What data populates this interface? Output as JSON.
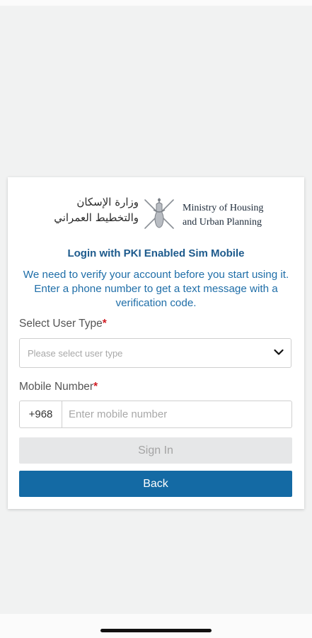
{
  "logo": {
    "arabic_line1": "وزارة الإسكان",
    "arabic_line2": "والتخطيط العمراني",
    "english_line1": "Ministry of Housing",
    "english_line2": "and Urban Planning",
    "emblem_icon": "oman-khanjar-emblem-icon"
  },
  "login": {
    "title": "Login with PKI Enabled Sim Mobile",
    "description": "We need to verify your account before you start using it. Enter a phone number to get a text message with a verification code."
  },
  "user_type": {
    "label": "Select User Type",
    "required_mark": "*",
    "placeholder": "Please select user type",
    "icon": "chevron-down-icon"
  },
  "mobile": {
    "label": "Mobile Number",
    "required_mark": "*",
    "country_code": "+968",
    "placeholder": "Enter mobile number",
    "value": ""
  },
  "buttons": {
    "sign_in": "Sign In",
    "back": "Back"
  },
  "colors": {
    "primary": "#146aa4",
    "title": "#1d5a8c",
    "required": "#d01d24",
    "disabled_button": "#e6e7e8"
  }
}
